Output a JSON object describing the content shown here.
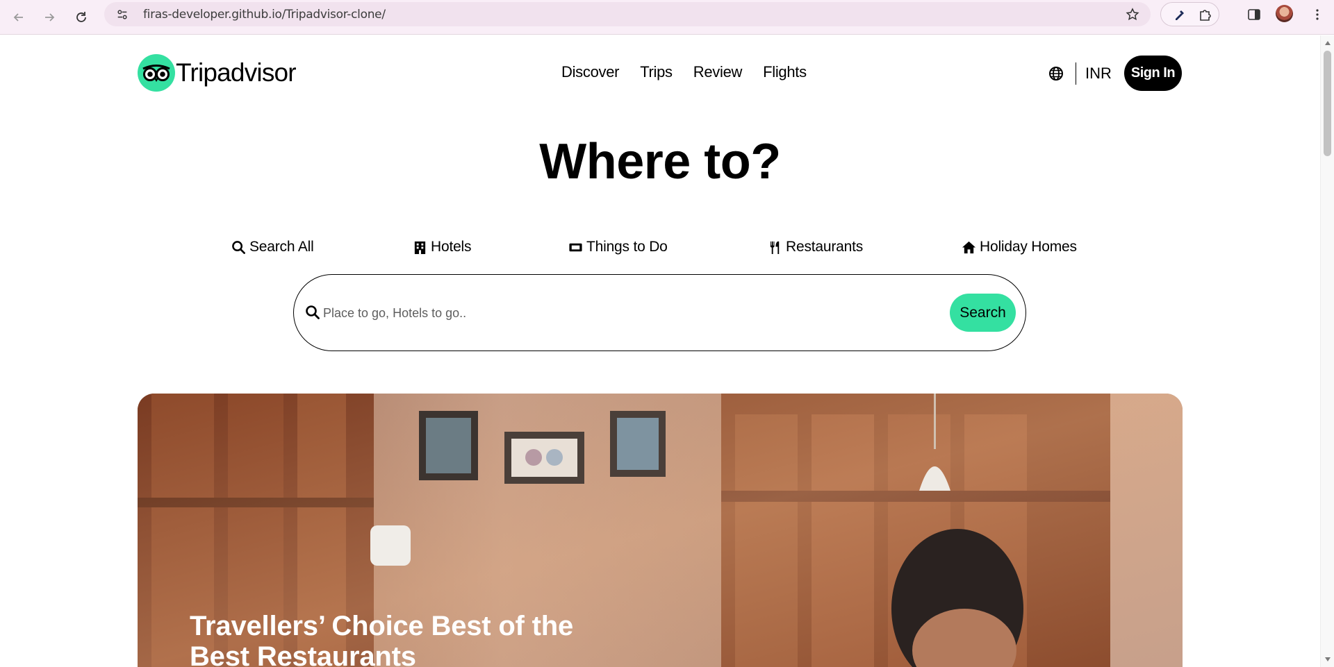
{
  "browser": {
    "url": "firas-developer.github.io/Tripadvisor-clone/"
  },
  "header": {
    "logo_text": "Tripadvisor",
    "nav": [
      "Discover",
      "Trips",
      "Review",
      "Flights"
    ],
    "currency": "INR",
    "signin_label": "Sign In"
  },
  "hero": {
    "title": "Where to?"
  },
  "categories": [
    {
      "label": "Search All",
      "icon": "search-icon"
    },
    {
      "label": "Hotels",
      "icon": "hotel-building-icon"
    },
    {
      "label": "Things to Do",
      "icon": "ticket-icon"
    },
    {
      "label": "Restaurants",
      "icon": "utensils-icon"
    },
    {
      "label": "Holiday Homes",
      "icon": "home-icon"
    }
  ],
  "search": {
    "placeholder": "Place to go, Hotels to go..",
    "button_label": "Search"
  },
  "banner": {
    "title": "Travellers’ Choice Best of the Best Restaurants"
  },
  "colors": {
    "brand_green": "#34e0a1",
    "signin_bg": "#000000"
  }
}
